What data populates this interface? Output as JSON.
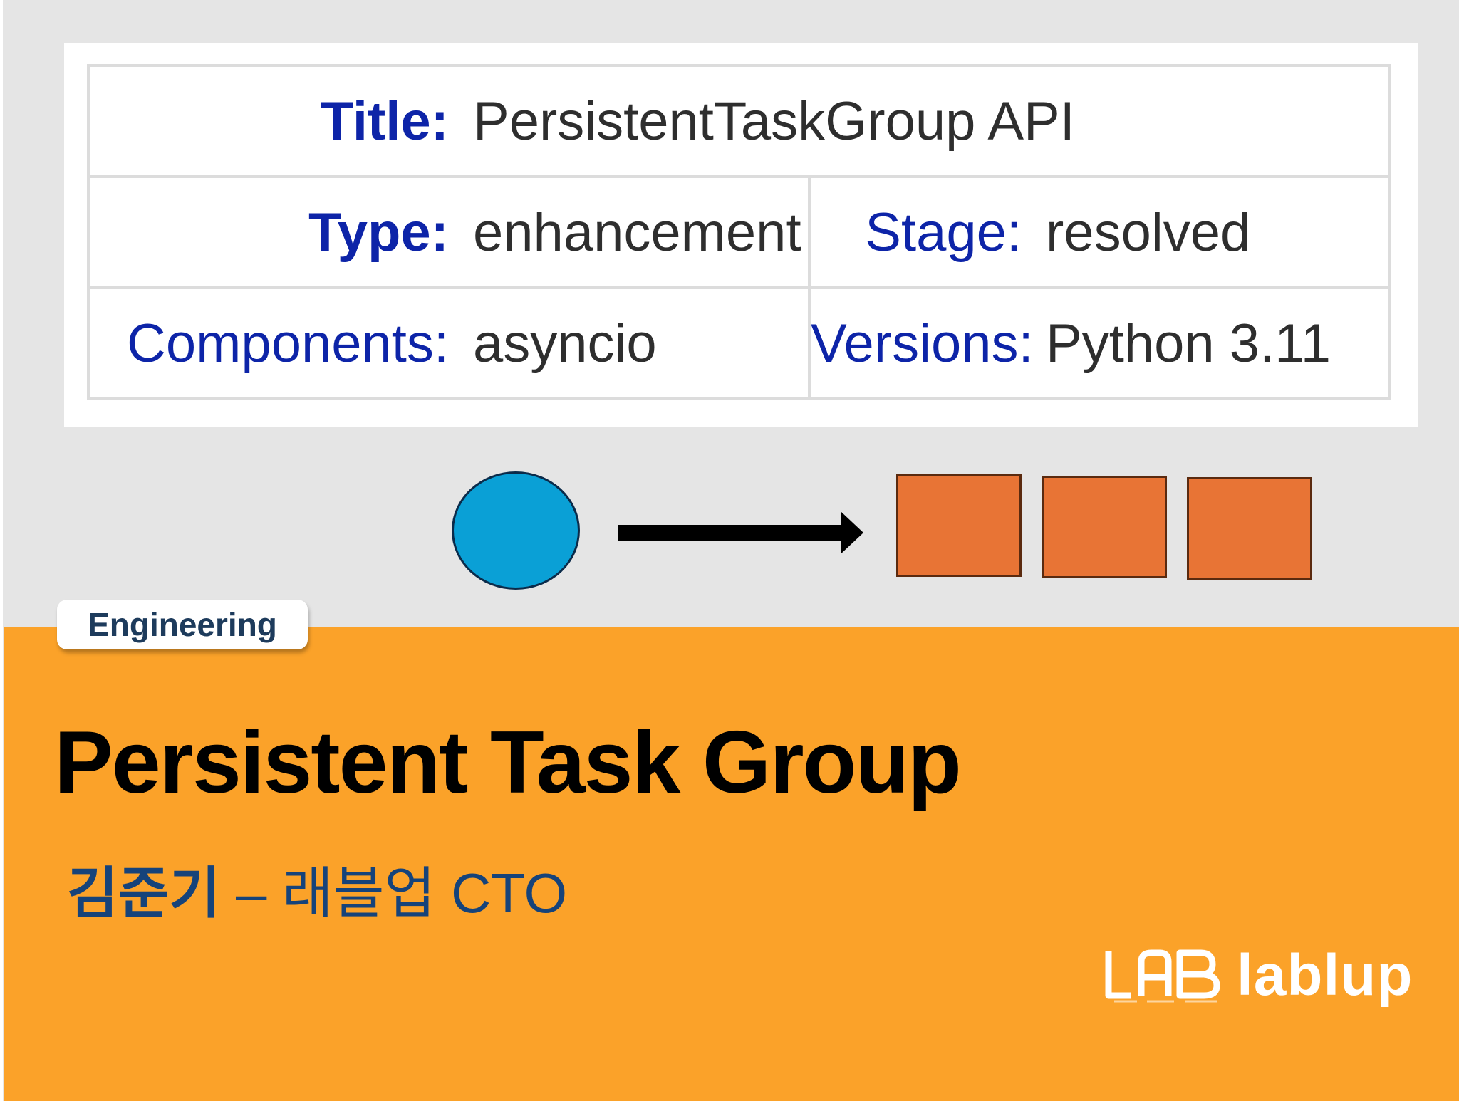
{
  "metadata": {
    "title_label": "Title:",
    "title_value": "PersistentTaskGroup API",
    "type_label": "Type:",
    "type_value": "enhancement",
    "stage_label": "Stage:",
    "stage_value": "resolved",
    "components_label": "Components:",
    "components_value": "asyncio",
    "versions_label": "Versions:",
    "versions_value": "Python 3.11"
  },
  "diagram": {
    "circle_color": "#0aa0d6",
    "box_color": "#e87435",
    "box_count": 3
  },
  "banner": {
    "category": "Engineering",
    "title": "Persistent Task Group",
    "author_name": "김준기",
    "author_role": "– 래블업 CTO",
    "logo_text": "lablup",
    "background_color": "#fba229"
  }
}
